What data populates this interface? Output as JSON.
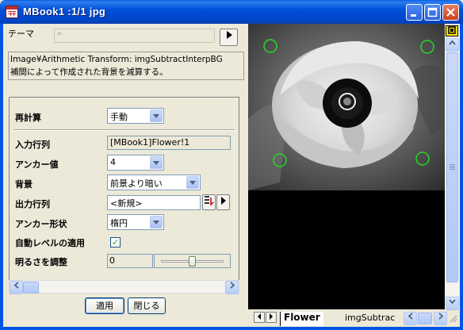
{
  "window": {
    "title": "MBook1 :1/1 jpg",
    "controls": [
      "minimize",
      "maximize",
      "close"
    ]
  },
  "theme": {
    "label": "テーマ",
    "value": "*"
  },
  "description": {
    "line1": "Image¥Arithmetic Transform: imgSubtractInterpBG",
    "line2": "補間によって作成された背景を減算する。"
  },
  "form": {
    "recalc": {
      "label": "再計算",
      "value": "手動"
    },
    "input": {
      "label": "入力行列",
      "value": "[MBook1]Flower!1"
    },
    "anchor_count": {
      "label": "アンカー値",
      "value": "4"
    },
    "background": {
      "label": "背景",
      "value": "前景より暗い"
    },
    "output": {
      "label": "出力行列",
      "value": "<新規>"
    },
    "anchor_shape": {
      "label": "アンカー形状",
      "value": "楕円"
    },
    "auto_level": {
      "label": "自動レベルの適用",
      "checked": true,
      "check_glyph": "✓"
    },
    "brightness": {
      "label": "明るさを調整",
      "value": "0",
      "slider_fraction": 0.5
    }
  },
  "buttons": {
    "apply": "適用",
    "close": "閉じる"
  },
  "sheet_tabs": {
    "active": "Flower",
    "other": "imgSubtrac"
  },
  "colors": {
    "title_bar": "#0050d8",
    "anchor_circle": "#22dd22",
    "check": "#21a121"
  }
}
